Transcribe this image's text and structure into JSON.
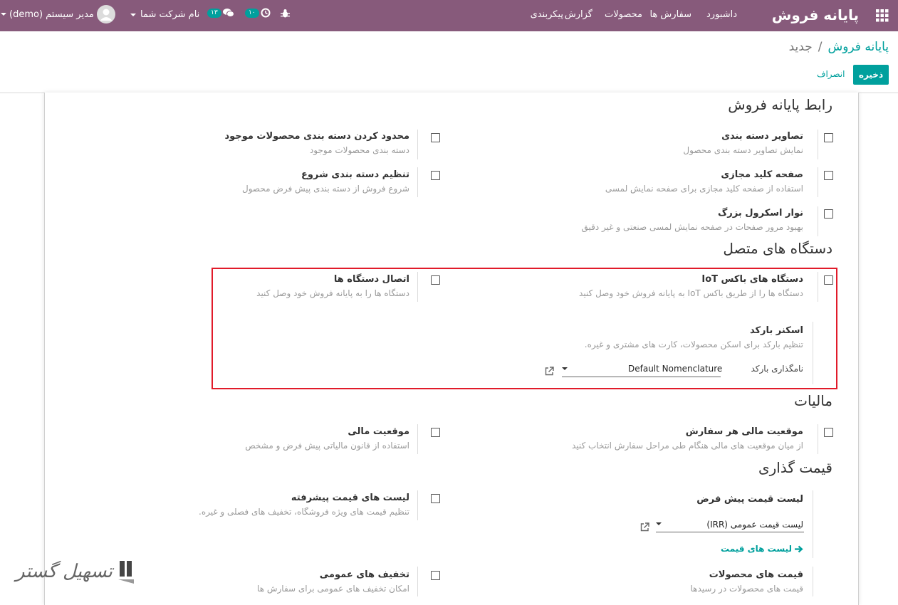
{
  "navbar": {
    "app_title": "پایانه فروش",
    "menu": [
      "داشبورد",
      "سفارش ها",
      "محصولات",
      "گزارش",
      "پیکربندی"
    ],
    "activity_count": "۱۰",
    "messages_count": "۱۳",
    "company_switch": "نام شرکت شما",
    "user_name": "مدیر سیستم (demo)"
  },
  "breadcrumb": {
    "parent": "پایانه فروش",
    "separator": "/",
    "current": "جدید"
  },
  "actions": {
    "save": "ذخیره",
    "discard": "انصراف"
  },
  "sections": {
    "pos_interface": {
      "title": "رابط پایانه فروش",
      "category_images": {
        "title": "تصاویر دسته بندی",
        "desc": "نمایش تصاویر دسته بندی محصول"
      },
      "restrict_categories": {
        "title": "محدود کردن دسته بندی محصولات موجود",
        "desc": "دسته بندی محصولات موجود"
      },
      "virtual_keyboard": {
        "title": "صفحه کلید مجازی",
        "desc": "استفاده از صفحه کلید مجازی برای صفحه نمایش لمسی"
      },
      "start_category": {
        "title": "تنظیم دسته بندی شروع",
        "desc": "شروع فروش از دسته بندی پیش فرض محصول"
      },
      "large_scrollbar": {
        "title": "نوار اسکرول بزرگ",
        "desc": "بهبود مرور صفحات در صفحه نمایش لمسی صنعتی و غیر دقیق"
      }
    },
    "connected_devices": {
      "title": "دستگاه های متصل",
      "iot_box": {
        "title": "دستگاه های باکس IoT",
        "desc": "دستگاه ها را از طریق باکس IoT به پایانه فروش خود وصل کنید"
      },
      "connect_devices": {
        "title": "اتصال دستگاه ها",
        "desc": "دستگاه ها را به پایانه فروش خود وصل کنید"
      },
      "barcode_scanner": {
        "title": "اسکنر بارکد",
        "desc": "تنظیم بارکد برای اسکن محصولات، کارت های مشتری و غیره.",
        "field_label": "نامگذاری بارکد",
        "field_value": "Default Nomenclature"
      }
    },
    "taxes": {
      "title": "مالیات",
      "fiscal_position_per_order": {
        "title": "موقعیت مالی هر سفارش",
        "desc": "از میان موقعیت های مالی هنگام طی مراحل سفارش انتخاب کنید"
      },
      "fiscal_position": {
        "title": "موقعیت مالی",
        "desc": "استفاده از قانون مالیاتی پیش فرض و مشخص"
      }
    },
    "pricing": {
      "title": "قیمت گذاری",
      "default_pricelist": {
        "title": "لیست قیمت پیش فرض",
        "field_value": "لیست قیمت عمومی (IRR)",
        "link": "لیست های قیمت"
      },
      "advanced_pricelists": {
        "title": "لیست های قیمت پیشرفته",
        "desc": "تنظیم قیمت های ویژه فروشگاه، تخفیف های فصلی و غیره."
      },
      "product_prices": {
        "title": "قیمت های محصولات",
        "desc": "قیمت های محصولات در رسیدها"
      },
      "global_discounts": {
        "title": "تخفیف های عمومی",
        "desc": "امکان تخفیف های عمومی برای سفارش ها"
      }
    }
  },
  "watermark": {
    "text": "تسهیل گستر"
  },
  "colors": {
    "navbar": "#875a7b",
    "accent": "#00a09d",
    "highlight": "#e11b2a"
  }
}
